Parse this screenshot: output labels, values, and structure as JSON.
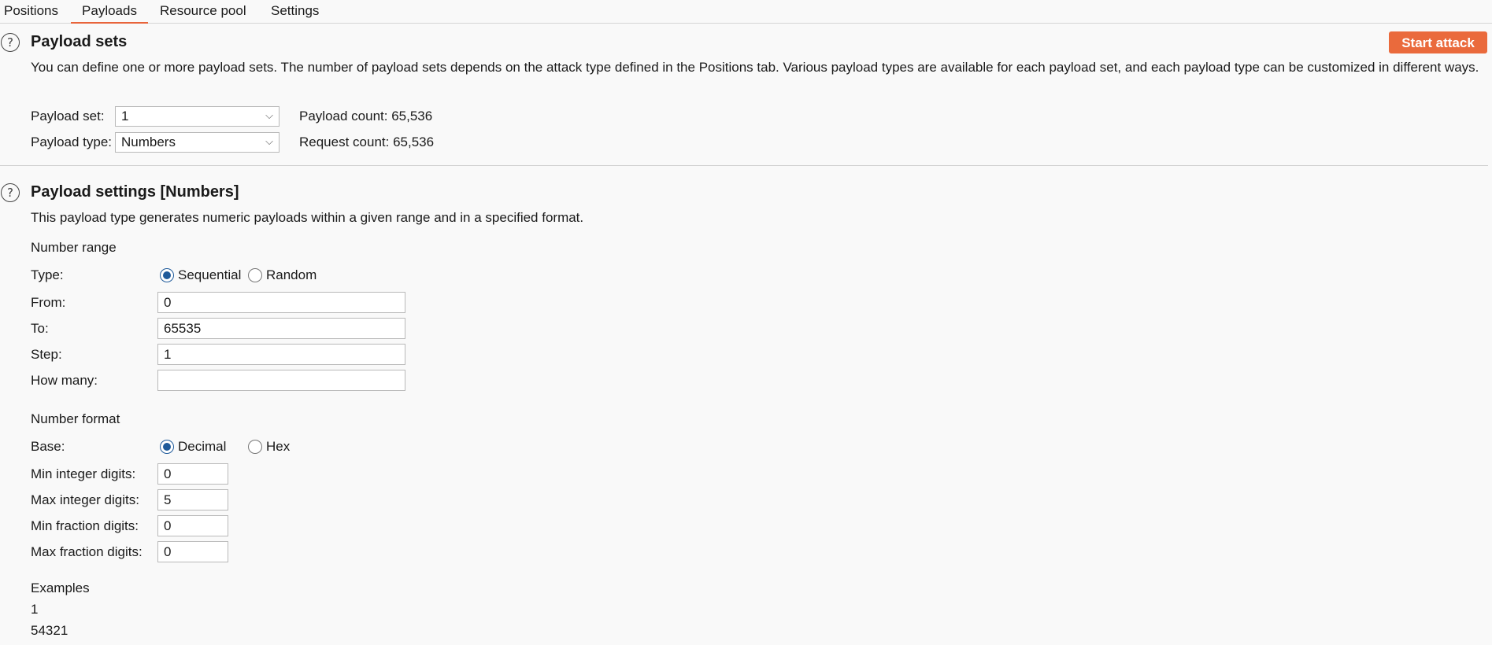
{
  "tabs": [
    {
      "label": "Positions"
    },
    {
      "label": "Payloads"
    },
    {
      "label": "Resource pool"
    },
    {
      "label": "Settings"
    }
  ],
  "payload_sets": {
    "title": "Payload sets",
    "description": "You can define one or more payload sets. The number of payload sets depends on the attack type defined in the Positions tab. Various payload types are available for each payload set, and each payload type can be customized in different ways.",
    "start_attack_label": "Start attack",
    "set_label": "Payload set:",
    "set_value": "1",
    "type_label": "Payload type:",
    "type_value": "Numbers",
    "payload_count": "Payload count: 65,536",
    "request_count": "Request count: 65,536"
  },
  "payload_settings": {
    "title": "Payload settings [Numbers]",
    "description": "This payload type generates numeric payloads within a given range and in a specified format.",
    "number_range": {
      "heading": "Number range",
      "type_label": "Type:",
      "type_options": [
        "Sequential",
        "Random"
      ],
      "type_selected": "Sequential",
      "from_label": "From:",
      "from_value": "0",
      "to_label": "To:",
      "to_value": "65535",
      "step_label": "Step:",
      "step_value": "1",
      "how_many_label": "How many:",
      "how_many_value": ""
    },
    "number_format": {
      "heading": "Number format",
      "base_label": "Base:",
      "base_options": [
        "Decimal",
        "Hex"
      ],
      "base_selected": "Decimal",
      "min_int_label": "Min integer digits:",
      "min_int_value": "0",
      "max_int_label": "Max integer digits:",
      "max_int_value": "5",
      "min_frac_label": "Min fraction digits:",
      "min_frac_value": "0",
      "max_frac_label": "Max fraction digits:",
      "max_frac_value": "0"
    },
    "examples": {
      "heading": "Examples",
      "values": [
        "1",
        "54321"
      ]
    }
  },
  "colors": {
    "accent": "#ea6a3c",
    "radio_selected": "#1f5a9a"
  },
  "icons": {
    "help": "help-icon",
    "dropdown": "chevron-down-icon"
  }
}
